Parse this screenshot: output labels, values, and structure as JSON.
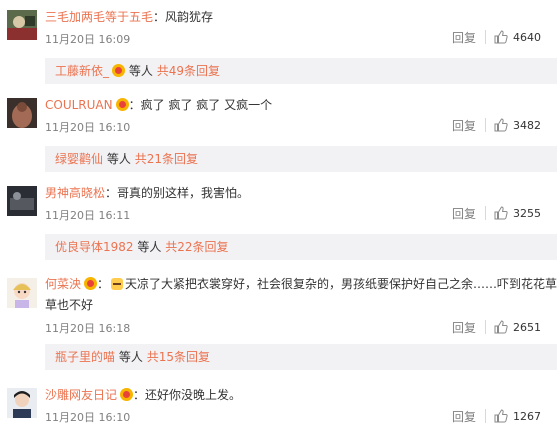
{
  "comments": [
    {
      "username": "三毛加两毛等于五毛",
      "has_badge": false,
      "text": "风韵犹存",
      "text_line2": "",
      "time": "11月20日 16:09",
      "reply_label": "回复",
      "likes": "4640",
      "sub": {
        "name": "工藤新依_",
        "has_badge": true,
        "etc": "等人",
        "more": "共49条回复"
      }
    },
    {
      "username": "COULRUAN",
      "has_badge": true,
      "text": "疯了 疯了 疯了 又疯一个",
      "text_line2": "",
      "time": "11月20日 16:10",
      "reply_label": "回复",
      "likes": "3482",
      "sub": {
        "name": "绿婴鹳仙",
        "has_badge": false,
        "etc": "等人",
        "more": "共21条回复"
      }
    },
    {
      "username": "男神高晓松",
      "has_badge": false,
      "text": "哥真的别这样，我害怕。",
      "text_line2": "",
      "time": "11月20日 16:11",
      "reply_label": "回复",
      "likes": "3255",
      "sub": {
        "name": "优良导体1982",
        "has_badge": false,
        "etc": "等人",
        "more": "共22条回复"
      }
    },
    {
      "username": "何菜泱",
      "has_badge": true,
      "text": "天凉了大紧把衣裳穿好，社会很复杂的，男孩纸要保护好自己之余……吓到花花草",
      "text_line2": "草也不好",
      "time": "11月20日 16:18",
      "reply_label": "回复",
      "likes": "2651",
      "sub": {
        "name": "瓶子里的喵",
        "has_badge": false,
        "etc": "等人",
        "more": "共15条回复"
      }
    },
    {
      "username": "沙雕网友日记",
      "has_badge": true,
      "text": "还好你没晚上发。",
      "text_line2": "",
      "time": "11月20日 16:10",
      "reply_label": "回复",
      "likes": "1267",
      "sub": null
    }
  ],
  "colors": {
    "link": "#eb7350",
    "meta": "#808080",
    "subbox_bg": "#f2f2f5"
  },
  "icons": {
    "like": "thumbs-up-icon",
    "badge": "vip-badge-icon",
    "emoji": "emoji-icon"
  }
}
